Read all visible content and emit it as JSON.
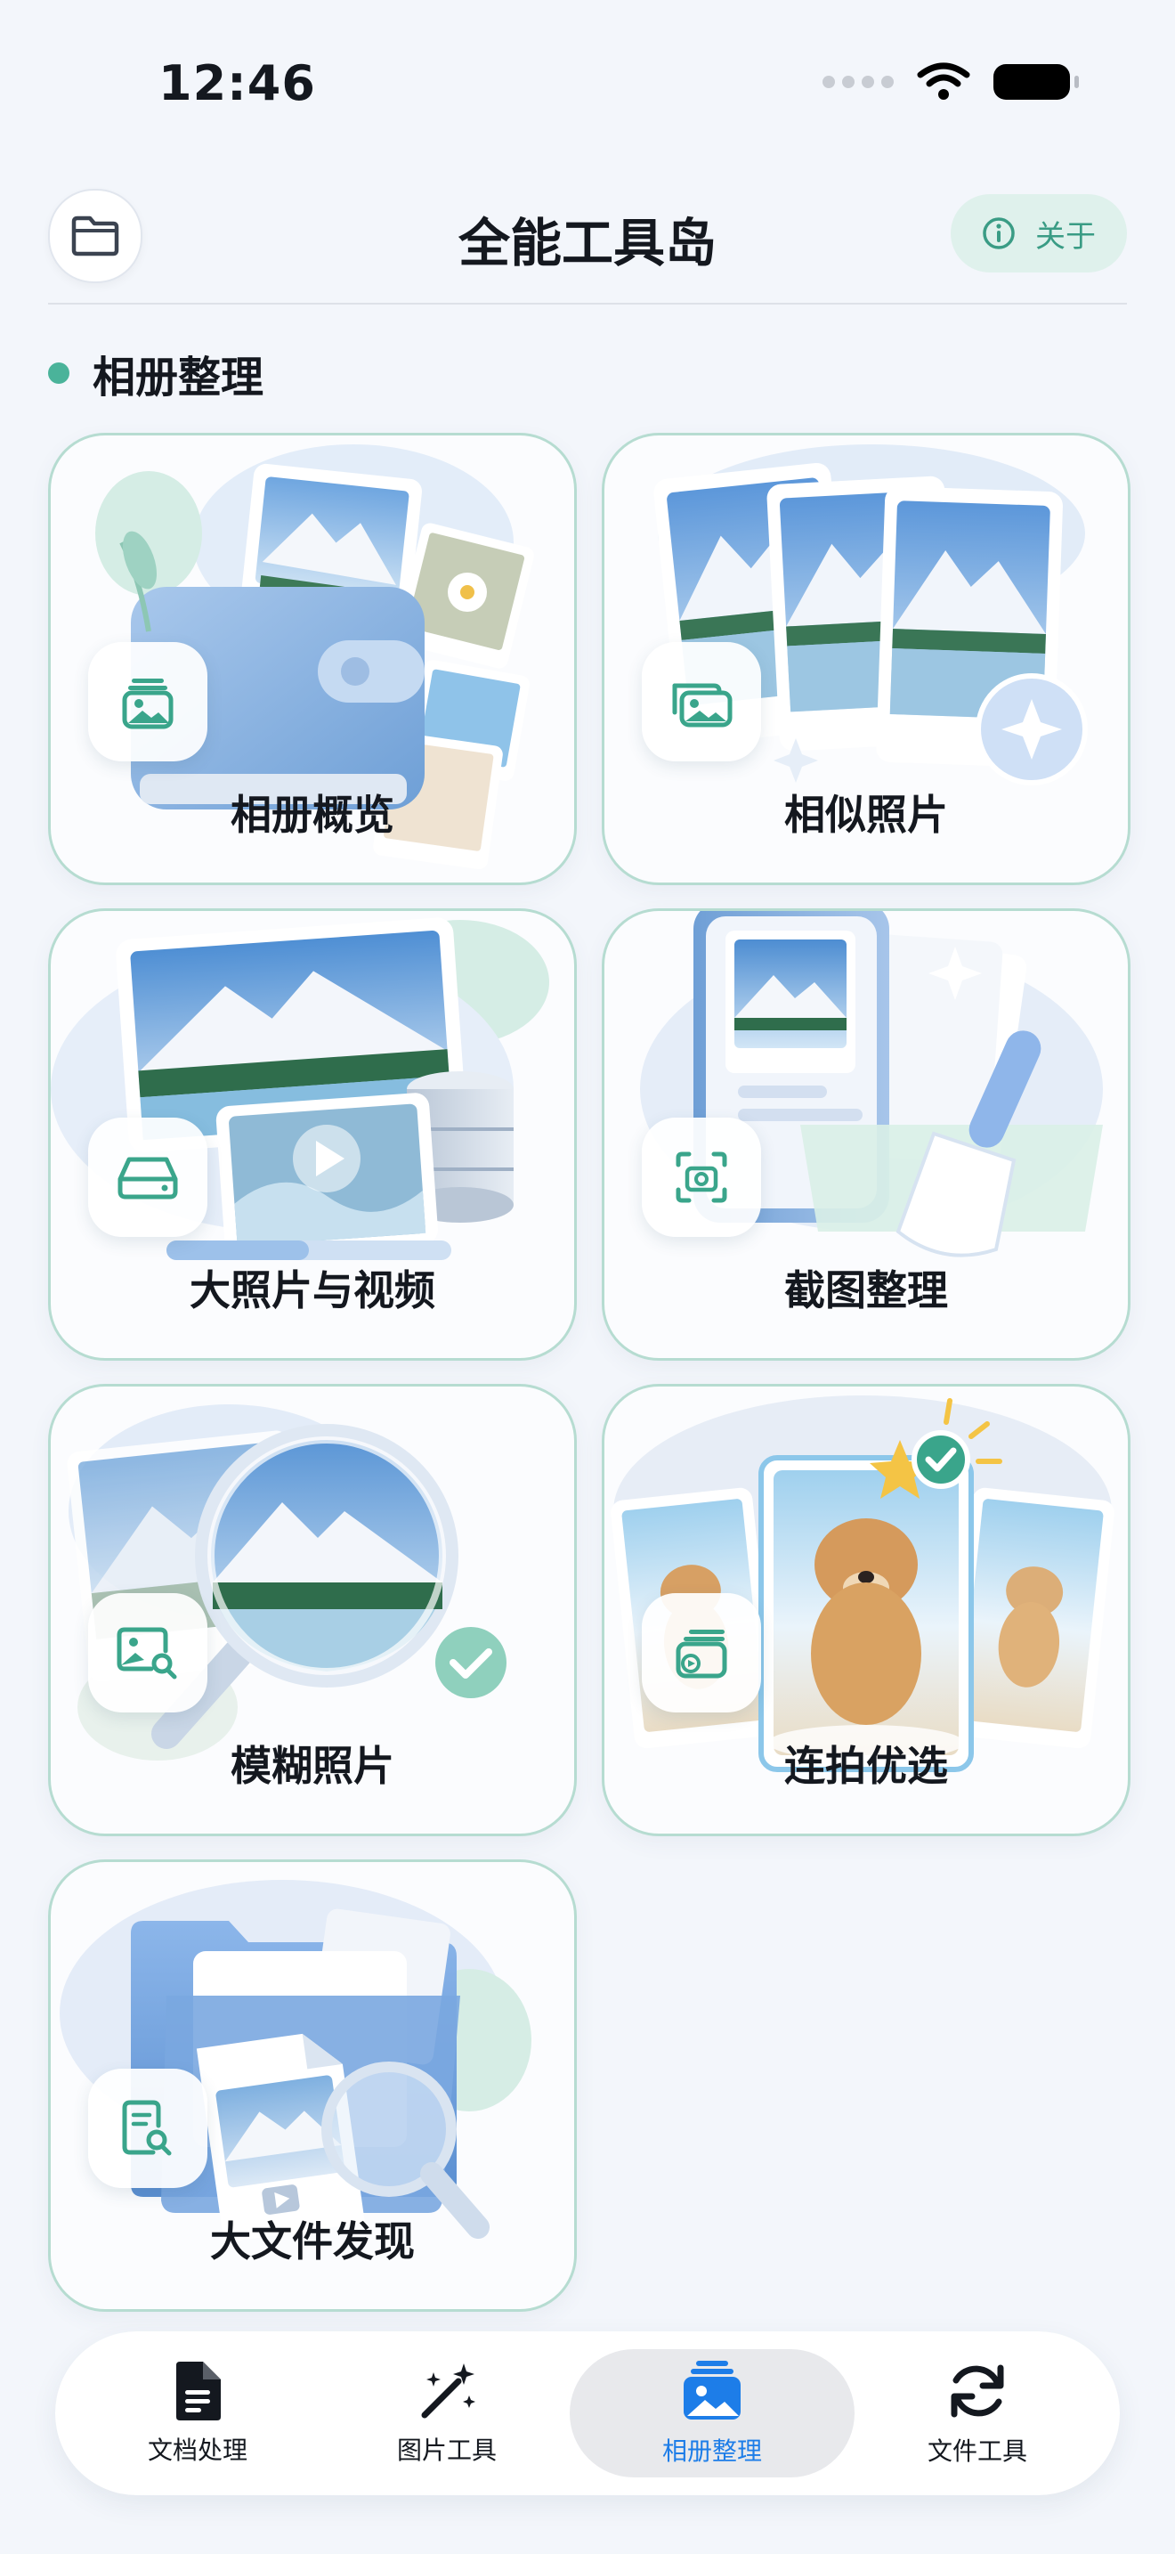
{
  "status": {
    "time": "12:46"
  },
  "header": {
    "title": "全能工具岛",
    "about_label": "关于"
  },
  "section": {
    "title": "相册整理"
  },
  "cards": [
    {
      "label": "相册概览",
      "icon": "photo-stack-icon"
    },
    {
      "label": "相似照片",
      "icon": "photos-icon"
    },
    {
      "label": "大照片与视频",
      "icon": "storage-drive-icon"
    },
    {
      "label": "截图整理",
      "icon": "screenshot-icon"
    },
    {
      "label": "模糊照片",
      "icon": "photo-search-icon"
    },
    {
      "label": "连拍优选",
      "icon": "burst-icon"
    },
    {
      "label": "大文件发现",
      "icon": "doc-search-icon"
    }
  ],
  "tabs": [
    {
      "label": "文档处理",
      "icon": "document-icon",
      "active": false
    },
    {
      "label": "图片工具",
      "icon": "magic-wand-icon",
      "active": false
    },
    {
      "label": "相册整理",
      "icon": "photo-stack-icon",
      "active": true
    },
    {
      "label": "文件工具",
      "icon": "sync-icon",
      "active": false
    }
  ],
  "colors": {
    "accent": "#4ab39a",
    "active_tab": "#1d7de8",
    "card_border": "#b6dcd1"
  }
}
